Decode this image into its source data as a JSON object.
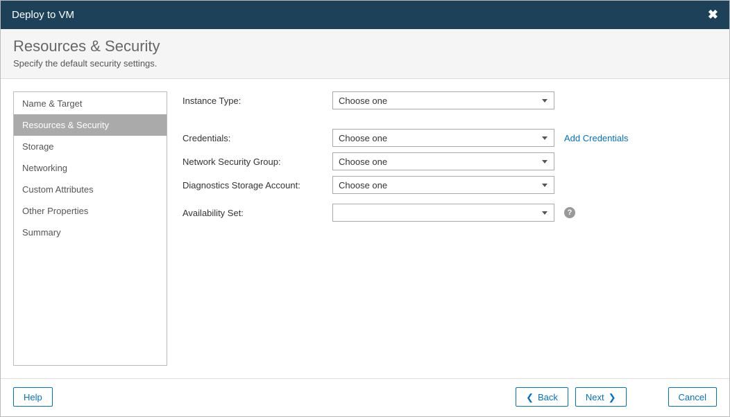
{
  "dialog": {
    "title": "Deploy to VM"
  },
  "header": {
    "title": "Resources & Security",
    "subtitle": "Specify the default security settings."
  },
  "steps": [
    {
      "label": "Name & Target"
    },
    {
      "label": "Resources & Security"
    },
    {
      "label": "Storage"
    },
    {
      "label": "Networking"
    },
    {
      "label": "Custom Attributes"
    },
    {
      "label": "Other Properties"
    },
    {
      "label": "Summary"
    }
  ],
  "form": {
    "instance_type": {
      "label": "Instance Type:",
      "value": "Choose one"
    },
    "credentials": {
      "label": "Credentials:",
      "value": "Choose one",
      "add_link": "Add Credentials"
    },
    "nsg": {
      "label": "Network Security Group:",
      "value": "Choose one"
    },
    "diag_storage": {
      "label": "Diagnostics Storage Account:",
      "value": "Choose one"
    },
    "availability": {
      "label": "Availability Set:",
      "value": ""
    }
  },
  "footer": {
    "help": "Help",
    "back": "Back",
    "next": "Next",
    "cancel": "Cancel"
  }
}
